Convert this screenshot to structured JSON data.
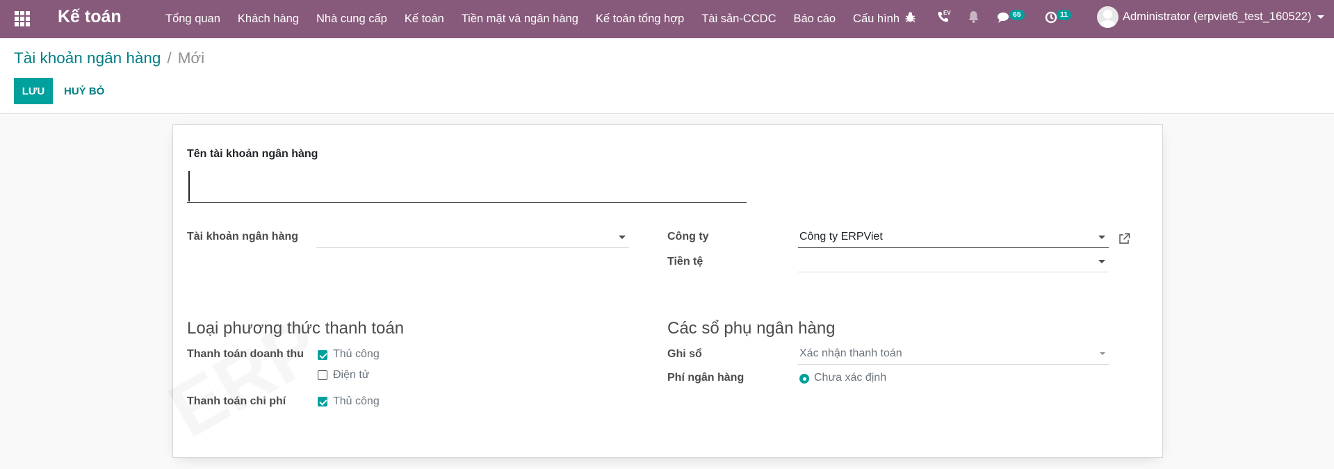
{
  "navbar": {
    "brand": "Kế toán",
    "menu": [
      "Tổng quan",
      "Khách hàng",
      "Nhà cung cấp",
      "Kế toán",
      "Tiền mặt và ngân hàng",
      "Kế toán tổng hợp",
      "Tài sản-CCDC",
      "Báo cáo",
      "Cấu hình"
    ],
    "voip_label": "EV",
    "messages_count": "65",
    "activities_count": "11",
    "user_name": "Administrator (erpviet6_test_160522)"
  },
  "breadcrumb": {
    "parent": "Tài khoản ngân hàng",
    "separator": "/",
    "current": "Mới"
  },
  "buttons": {
    "save": "LƯU",
    "discard": "HUỶ BỎ"
  },
  "form": {
    "name_label": "Tên tài khoản ngân hàng",
    "name_value": "",
    "bank_account_label": "Tài khoản ngân hàng",
    "bank_account_value": "",
    "company_label": "Công ty",
    "company_value": "Công ty ERPViet",
    "currency_label": "Tiền tệ",
    "currency_value": "",
    "payment_methods_title": "Loại phương thức thanh toán",
    "inbound_label": "Thanh toán doanh thu",
    "inbound_options": [
      {
        "label": "Thủ công",
        "checked": true
      },
      {
        "label": "Điện tử",
        "checked": false
      }
    ],
    "outbound_label": "Thanh toán chi phí",
    "outbound_options": [
      {
        "label": "Thủ công",
        "checked": true
      }
    ],
    "bank_journals_title": "Các sổ phụ ngân hàng",
    "post_at_label": "Ghi sổ",
    "post_at_value": "Xác nhận thanh toán",
    "bank_fee_label": "Phí ngân hàng",
    "bank_fee_value": "Chưa xác định"
  },
  "colors": {
    "navbar": "#875a7b",
    "primary": "#00a09d",
    "link": "#017e84"
  }
}
